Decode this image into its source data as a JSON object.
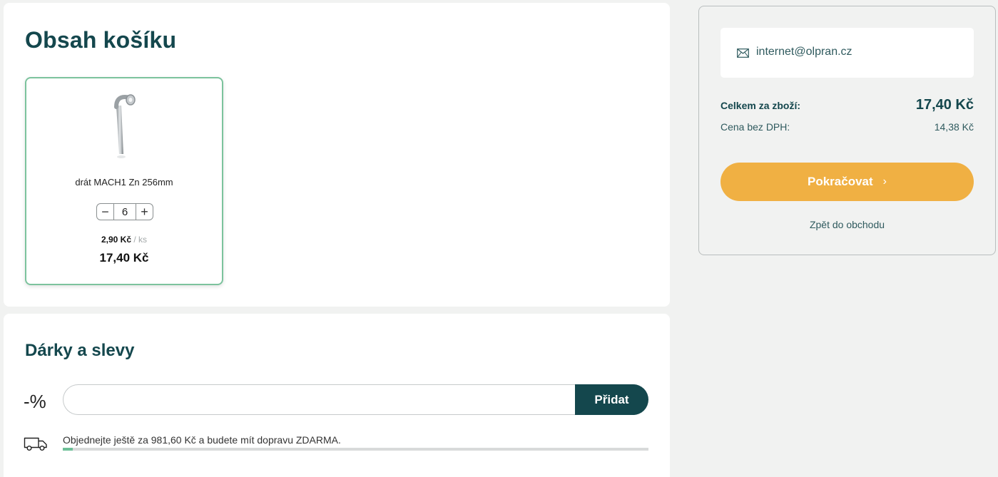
{
  "cart": {
    "title": "Obsah košíku",
    "item": {
      "name": "drát MACH1 Zn 256mm",
      "quantity": "6",
      "unit_price": "2,90 Kč",
      "unit_sep": " / ",
      "unit": "ks",
      "total": "17,40 Kč",
      "minus_symbol": "−",
      "plus_symbol": "+"
    }
  },
  "gifts": {
    "title": "Dárky a slevy",
    "percent_symbol": "-%",
    "coupon_placeholder": "",
    "add_button": "Přidat",
    "shipping_text": "Objednejte ještě za 981,60 Kč a budete mít dopravu ZDARMA.",
    "shipping_progress": 0.017
  },
  "summary": {
    "email": "internet@olpran.cz",
    "total_label": "Celkem za zboží:",
    "total_value": "17,40 Kč",
    "net_label": "Cena bez DPH:",
    "net_value": "14,38 Kč",
    "continue_button": "Pokračovat",
    "continue_chevron": "›",
    "back_link": "Zpět do obchodu"
  },
  "colors": {
    "brand_dark": "#14474d",
    "accent_orange": "#f0b043",
    "accent_green": "#6dbf97"
  },
  "icons": {
    "mail": "mail-icon",
    "truck": "truck-icon",
    "chevron": "chevron-right-icon"
  }
}
